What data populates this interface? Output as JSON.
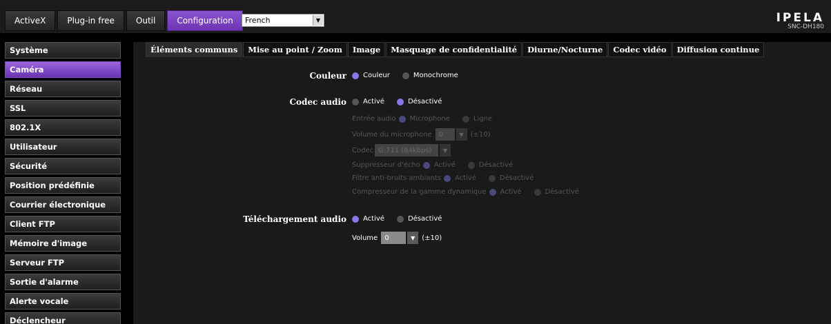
{
  "topnav": [
    "ActiveX",
    "Plug-in free",
    "Outil",
    "Configuration"
  ],
  "language": "French",
  "brand": {
    "logo": "IPELA",
    "model": "SNC-DH180"
  },
  "sidebar": [
    "Système",
    "Caméra",
    "Réseau",
    "SSL",
    "802.1X",
    "Utilisateur",
    "Sécurité",
    "Position prédéfinie",
    "Courrier électronique",
    "Client FTP",
    "Mémoire d'image",
    "Serveur FTP",
    "Sortie d'alarme",
    "Alerte vocale",
    "Déclencheur"
  ],
  "tabs": [
    "Éléments communs",
    "Mise au point / Zoom",
    "Image",
    "Masquage de confidentialité",
    "Diurne/Nocturne",
    "Codec vidéo",
    "Diffusion continue"
  ],
  "form": {
    "couleur": {
      "label": "Couleur",
      "opt1": "Couleur",
      "opt2": "Monochrome"
    },
    "codec_audio": {
      "label": "Codec audio",
      "opt1": "Activé",
      "opt2": "Désactivé"
    },
    "entree_audio": {
      "label": "Entrée audio",
      "opt1": "Microphone",
      "opt2": "Ligne"
    },
    "volume_micro": {
      "label": "Volume du microphone",
      "value": "0",
      "range": "(±10)"
    },
    "codec": {
      "label": "Codec",
      "value": "G.711 (64kbps)"
    },
    "suppresseur": {
      "label": "Suppresseur d'écho",
      "opt1": "Activé",
      "opt2": "Désactivé"
    },
    "filtre": {
      "label": "Filtre anti-bruits ambiants",
      "opt1": "Activé",
      "opt2": "Désactivé"
    },
    "compresseur": {
      "label": "Compresseur de la gamme dynamique",
      "opt1": "Activé",
      "opt2": "Désactivé"
    },
    "telechargement": {
      "label": "Téléchargement audio",
      "opt1": "Activé",
      "opt2": "Désactivé"
    },
    "volume": {
      "label": "Volume",
      "value": "0",
      "range": "(±10)"
    }
  },
  "colors": {
    "accent": "#7a46c2",
    "radio_on": "#8b74e8"
  }
}
